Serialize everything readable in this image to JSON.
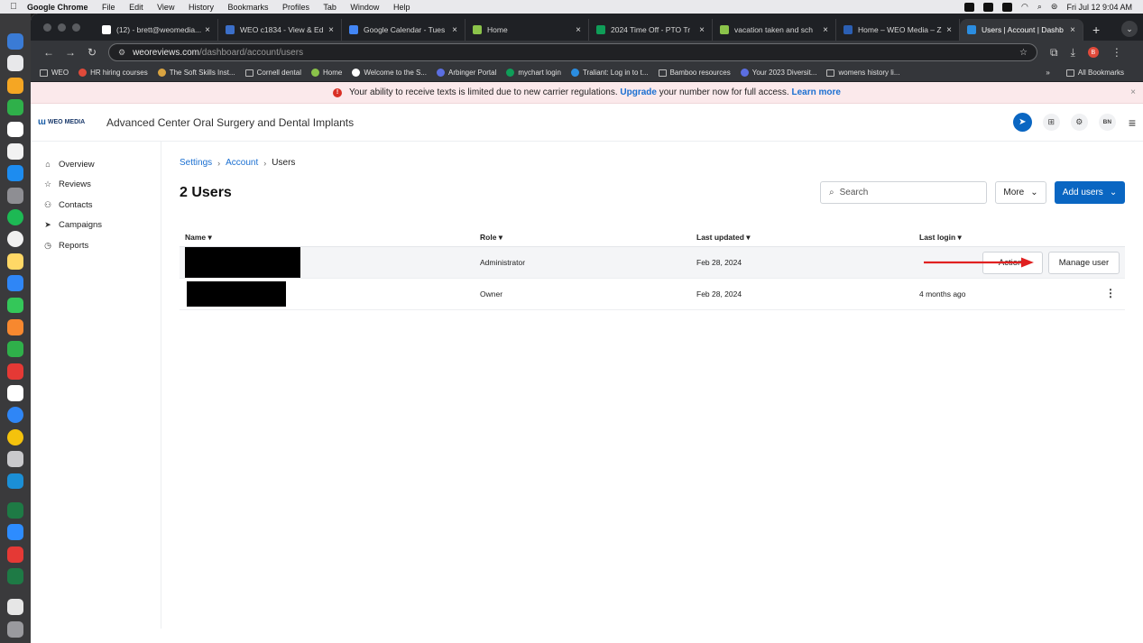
{
  "macos_menubar": {
    "app": "Google Chrome",
    "menus": [
      "File",
      "Edit",
      "View",
      "History",
      "Bookmarks",
      "Profiles",
      "Tab",
      "Window",
      "Help"
    ],
    "clock": "Fri Jul 12  9:04 AM"
  },
  "browser": {
    "tabs": [
      {
        "title": "(12) - brett@weomedia...",
        "color": "#ffffff"
      },
      {
        "title": "WEO c1834 - View & Ed",
        "color": "#3b6fc9"
      },
      {
        "title": "Google Calendar - Tues",
        "color": "#4285f4"
      },
      {
        "title": "Home",
        "color": "#8bc34a"
      },
      {
        "title": "2024 Time Off - PTO Tr",
        "color": "#0f9d58"
      },
      {
        "title": "vacation taken and sch",
        "color": "#8bc34a"
      },
      {
        "title": "Home – WEO Media – Z",
        "color": "#2b5fb3"
      },
      {
        "title": "Users | Account | Dashb",
        "color": "#2b8de0",
        "active": true
      }
    ],
    "url_host": "weoreviews.com",
    "url_path": "/dashboard/account/users",
    "profile_initial": "B",
    "bookmarks": [
      {
        "label": "WEO",
        "type": "folder"
      },
      {
        "label": "HR hiring courses",
        "type": "site",
        "color": "#e04a3a"
      },
      {
        "label": "The Soft Skills Inst...",
        "type": "site",
        "color": "#d9a441"
      },
      {
        "label": "Cornell dental",
        "type": "folder"
      },
      {
        "label": "Home",
        "type": "site",
        "color": "#8bc34a"
      },
      {
        "label": "Welcome to the S...",
        "type": "site",
        "color": "#ffffff"
      },
      {
        "label": "Arbinger Portal",
        "type": "site",
        "color": "#5b6ee1"
      },
      {
        "label": "mychart login",
        "type": "site",
        "color": "#0f9d58"
      },
      {
        "label": "Traliant: Log in to t...",
        "type": "site",
        "color": "#2b8de0"
      },
      {
        "label": "Bamboo resources",
        "type": "folder"
      },
      {
        "label": "Your 2023 Diversit...",
        "type": "site",
        "color": "#5b6ee1"
      },
      {
        "label": "womens history li...",
        "type": "folder"
      }
    ],
    "bookmarks_overflow": "»",
    "all_bookmarks": "All Bookmarks"
  },
  "banner": {
    "text_before": "Your ability to receive texts is limited due to new carrier regulations.",
    "upgrade_link": "Upgrade",
    "text_after": "your number now for full access.",
    "learn_more": "Learn more",
    "close": "×"
  },
  "header": {
    "logo_text": "WEO MEDIA",
    "company": "Advanced Center Oral Surgery and Dental Implants",
    "user_initials": "BN"
  },
  "sidebar": {
    "items": [
      {
        "label": "Overview",
        "icon": "home-icon",
        "glyph": "⌂"
      },
      {
        "label": "Reviews",
        "icon": "star-icon",
        "glyph": "☆"
      },
      {
        "label": "Contacts",
        "icon": "contacts-icon",
        "glyph": "⚇"
      },
      {
        "label": "Campaigns",
        "icon": "send-icon",
        "glyph": "➤"
      },
      {
        "label": "Reports",
        "icon": "reports-icon",
        "glyph": "◷"
      }
    ]
  },
  "breadcrumb": {
    "items": [
      "Settings",
      "Account",
      "Users"
    ]
  },
  "page": {
    "title": "2 Users",
    "search_placeholder": "Search",
    "more_label": "More",
    "add_users_label": "Add users"
  },
  "table": {
    "columns": [
      "Name",
      "Role",
      "Last updated",
      "Last login"
    ],
    "rows": [
      {
        "name": "",
        "role": "Administrator",
        "last_updated": "Feb 28, 2024",
        "last_login": ""
      },
      {
        "name": "",
        "role": "Owner",
        "last_updated": "Feb 28, 2024",
        "last_login": "4 months ago"
      }
    ],
    "actions_label": "Actions",
    "manage_label": "Manage user"
  },
  "colors": {
    "accent": "#0a66c2",
    "banner_bg": "#fbe9eb",
    "arrow": "#e02020"
  }
}
